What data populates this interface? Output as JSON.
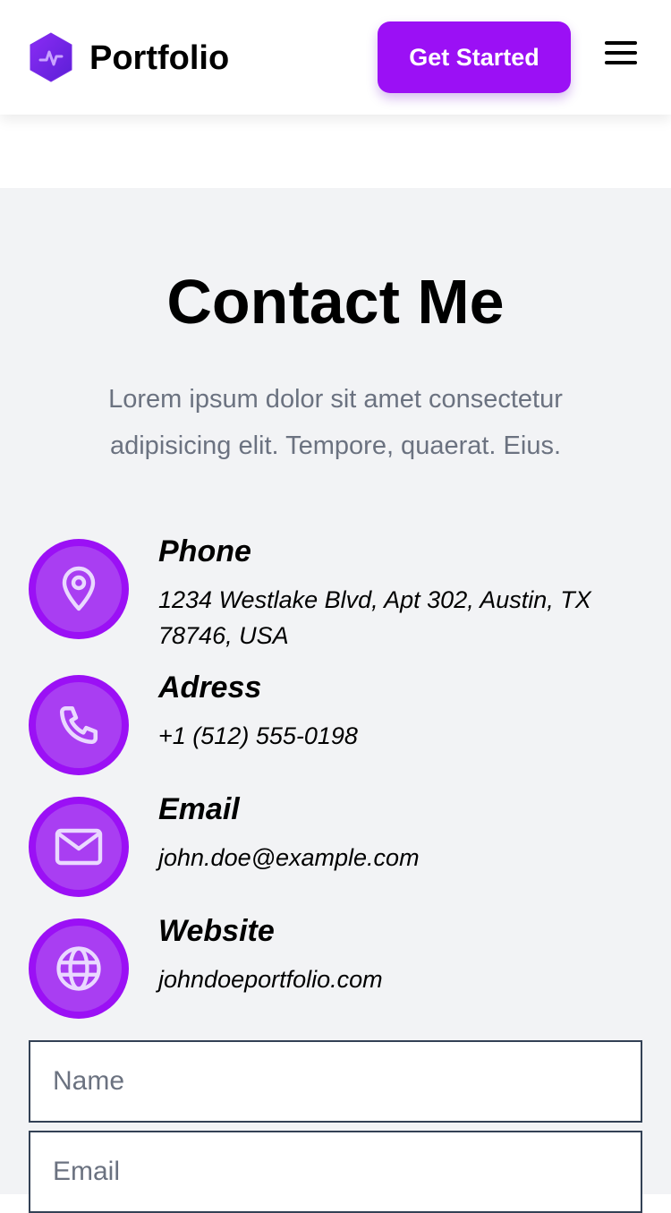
{
  "header": {
    "brand": "Portfolio",
    "cta_label": "Get Started",
    "logo_icon": "hexagon-pulse-logo",
    "menu_icon": "hamburger-menu-icon"
  },
  "colors": {
    "accent": "#9b10f5",
    "accent_inner": "#a93ef2",
    "section_bg": "#f2f3f5",
    "muted_text": "#6b7280"
  },
  "contact": {
    "title": "Contact Me",
    "intro": "Lorem ipsum dolor sit amet consectetur adipisicing elit. Tempore, quaerat. Eius.",
    "items": [
      {
        "icon": "map-pin-icon",
        "label": "Phone",
        "value": "1234 Westlake Blvd, Apt 302, Austin, TX 78746, USA"
      },
      {
        "icon": "phone-icon",
        "label": "Adress",
        "value": "+1 (512) 555-0198"
      },
      {
        "icon": "mail-icon",
        "label": "Email",
        "value": "john.doe@example.com"
      },
      {
        "icon": "globe-icon",
        "label": "Website",
        "value": "johndoeportfolio.com"
      }
    ]
  },
  "form": {
    "name_placeholder": "Name",
    "email_placeholder": "Email"
  }
}
